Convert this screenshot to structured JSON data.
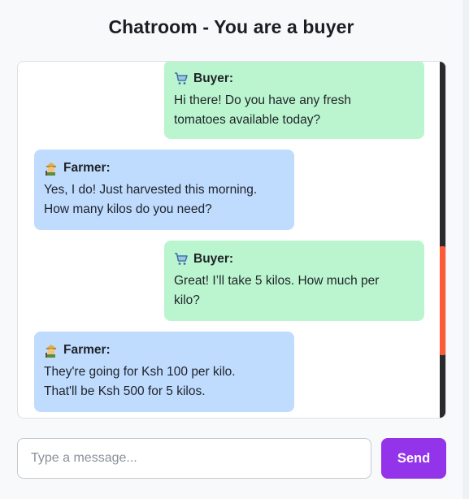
{
  "page": {
    "title": "Chatroom - You are a buyer"
  },
  "messages": [
    {
      "role": "buyer",
      "icon": "shopping-cart-icon",
      "sender": "Buyer:",
      "text_lines": [
        "Hi there! Do you have any fresh",
        "tomatoes available today?"
      ]
    },
    {
      "role": "farmer",
      "icon": "farmer-icon",
      "sender": "Farmer:",
      "text_lines": [
        "Yes, I do! Just harvested this morning.",
        "How many kilos do you need?"
      ]
    },
    {
      "role": "buyer",
      "icon": "shopping-cart-icon",
      "sender": "Buyer:",
      "text_lines": [
        "Great! I’ll take 5 kilos. How much per",
        "kilo?"
      ]
    },
    {
      "role": "farmer",
      "icon": "farmer-icon",
      "sender": "Farmer:",
      "text_lines": [
        "They're going for Ksh 100 per kilo.",
        "That'll be Ksh 500 for 5 kilos."
      ]
    }
  ],
  "composer": {
    "placeholder": "Type a message...",
    "value": "",
    "send_label": "Send"
  },
  "colors": {
    "buyer_bubble": "#bbf5cf",
    "farmer_bubble": "#bfdbfe",
    "send_button": "#9333ea",
    "scroll_thumb": "#ff5a36"
  }
}
